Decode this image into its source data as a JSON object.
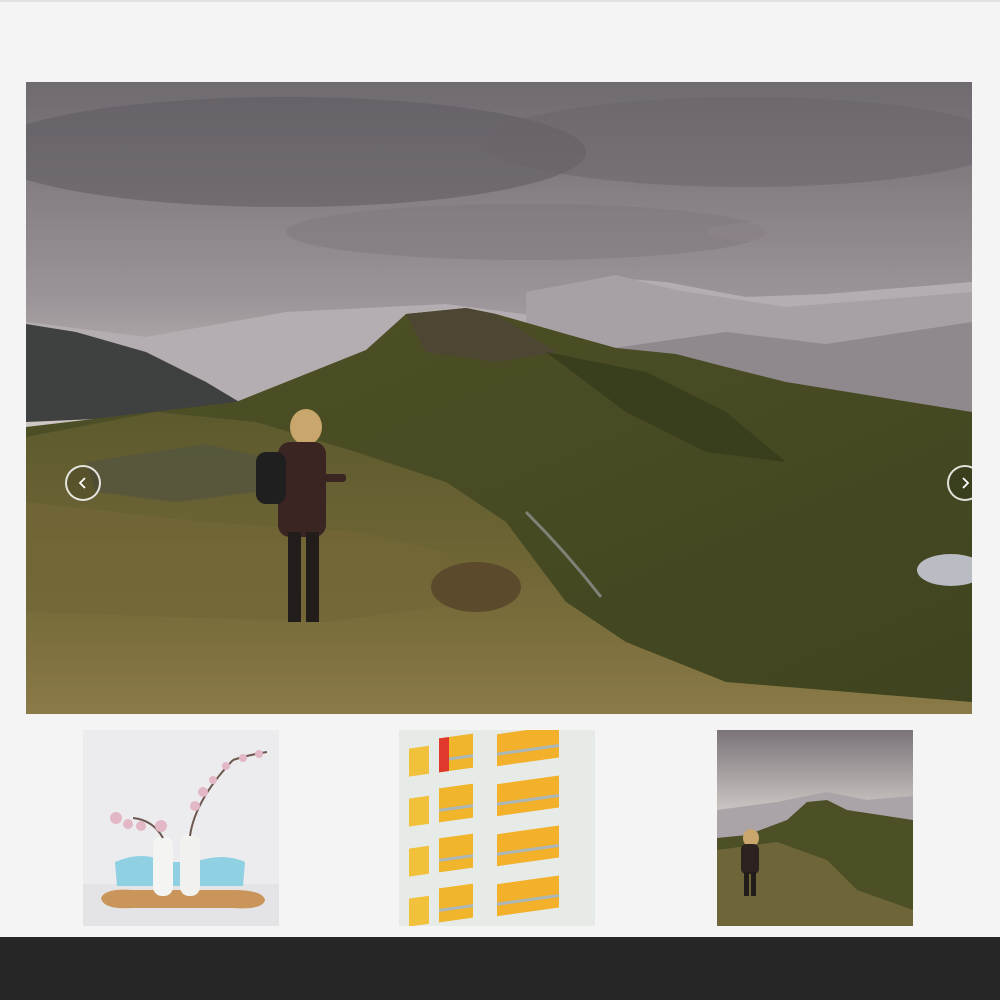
{
  "viewer": {
    "main_image": "mountain-hiker-landscape",
    "prev_icon": "chevron-left-icon",
    "next_icon": "chevron-right-icon"
  },
  "thumbnails": [
    {
      "subject": "vases-with-blossoms"
    },
    {
      "subject": "yellow-balcony-building"
    },
    {
      "subject": "mountain-hiker-landscape"
    }
  ],
  "colors": {
    "page_background": "#f4f4f4",
    "bottom_bar": "#262626",
    "nav_button_border": "#ffffff"
  }
}
